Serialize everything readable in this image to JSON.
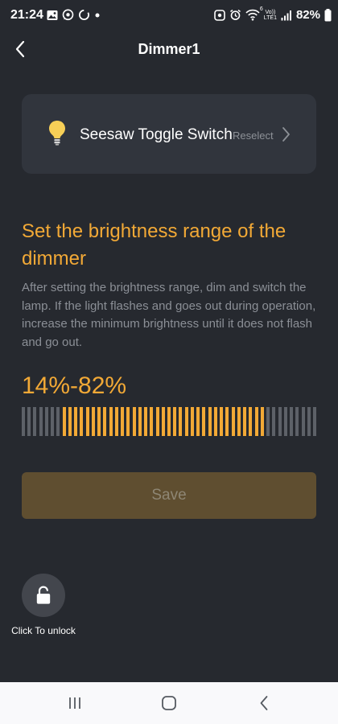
{
  "status_bar": {
    "time": "21:24",
    "battery": "82%",
    "network_top": "Vo))",
    "network_bottom": "LTE1",
    "wifi_band": "6"
  },
  "header": {
    "title": "Dimmer1"
  },
  "device": {
    "name": "Seesaw Toggle Switch",
    "reselect_label": "Reselect",
    "bulb_icon": "lightbulb-icon"
  },
  "brightness": {
    "heading": "Set the brightness range of the dimmer",
    "description": "After setting the brightness range, dim and switch the lamp. If the light flashes and goes out during operation, increase the minimum brightness until it does not flash and go out.",
    "range_text": "14%-82%",
    "min_percent": 14,
    "max_percent": 82,
    "active_color": "#f2a936",
    "inactive_color": "#5d6168"
  },
  "actions": {
    "save_label": "Save",
    "unlock_label": "Click To unlock"
  },
  "colors": {
    "background": "#26292f",
    "card": "#31353d",
    "accent": "#f2a936",
    "save_disabled": "#5f4e30"
  }
}
